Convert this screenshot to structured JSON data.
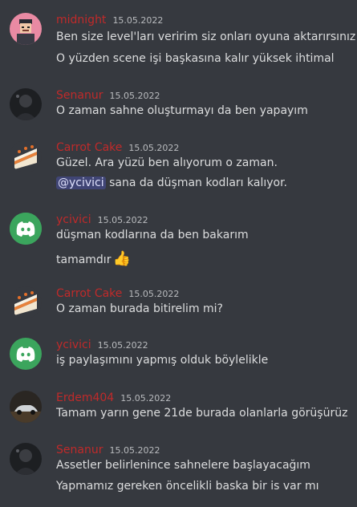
{
  "colors": {
    "background": "#36393f",
    "username": "#c02a2a",
    "timestamp": "#b9bbbe",
    "text": "#dcddde",
    "mention_bg": "#414675"
  },
  "messages": [
    {
      "user": "midnight",
      "time": "15.05.2022",
      "avatar": "pixel-avatar-icon",
      "lines": [
        "Ben size level'ları veririm siz onları oyuna aktarırsınız",
        "O yüzden scene işi başkasına kalır yüksek ihtimal"
      ]
    },
    {
      "user": "Senanur",
      "time": "15.05.2022",
      "avatar": "dark-avatar-icon",
      "lines": [
        "O zaman sahne oluşturmayı da ben yapayım"
      ]
    },
    {
      "user": "Carrot Cake",
      "time": "15.05.2022",
      "avatar": "cake-avatar-icon",
      "lines": [
        "Güzel. Ara yüzü ben alıyorum o zaman.",
        "sana da düşman kodları kalıyor."
      ],
      "mention": "@ycivici"
    },
    {
      "user": "ycivici",
      "time": "15.05.2022",
      "avatar": "discord-avatar-icon",
      "lines": [
        "düşman kodlarına da ben bakarım",
        "tamamdır"
      ],
      "emoji": "👍"
    },
    {
      "user": "Carrot Cake",
      "time": "15.05.2022",
      "avatar": "cake-avatar-icon",
      "lines": [
        "O zaman burada bitirelim mi?"
      ]
    },
    {
      "user": "ycivici",
      "time": "15.05.2022",
      "avatar": "discord-avatar-icon",
      "lines": [
        "iş paylaşımını yapmış olduk böylelikle"
      ]
    },
    {
      "user": "Erdem404",
      "time": "15.05.2022",
      "avatar": "car-avatar-icon",
      "lines": [
        "Tamam yarın gene 21de burada olanlarla görüşürüz"
      ]
    },
    {
      "user": "Senanur",
      "time": "15.05.2022",
      "avatar": "dark-avatar-icon",
      "lines": [
        "Assetler belirlenince sahnelere başlayacağım",
        "Yapmamız gereken öncelikli baska bir is var mı"
      ]
    }
  ]
}
